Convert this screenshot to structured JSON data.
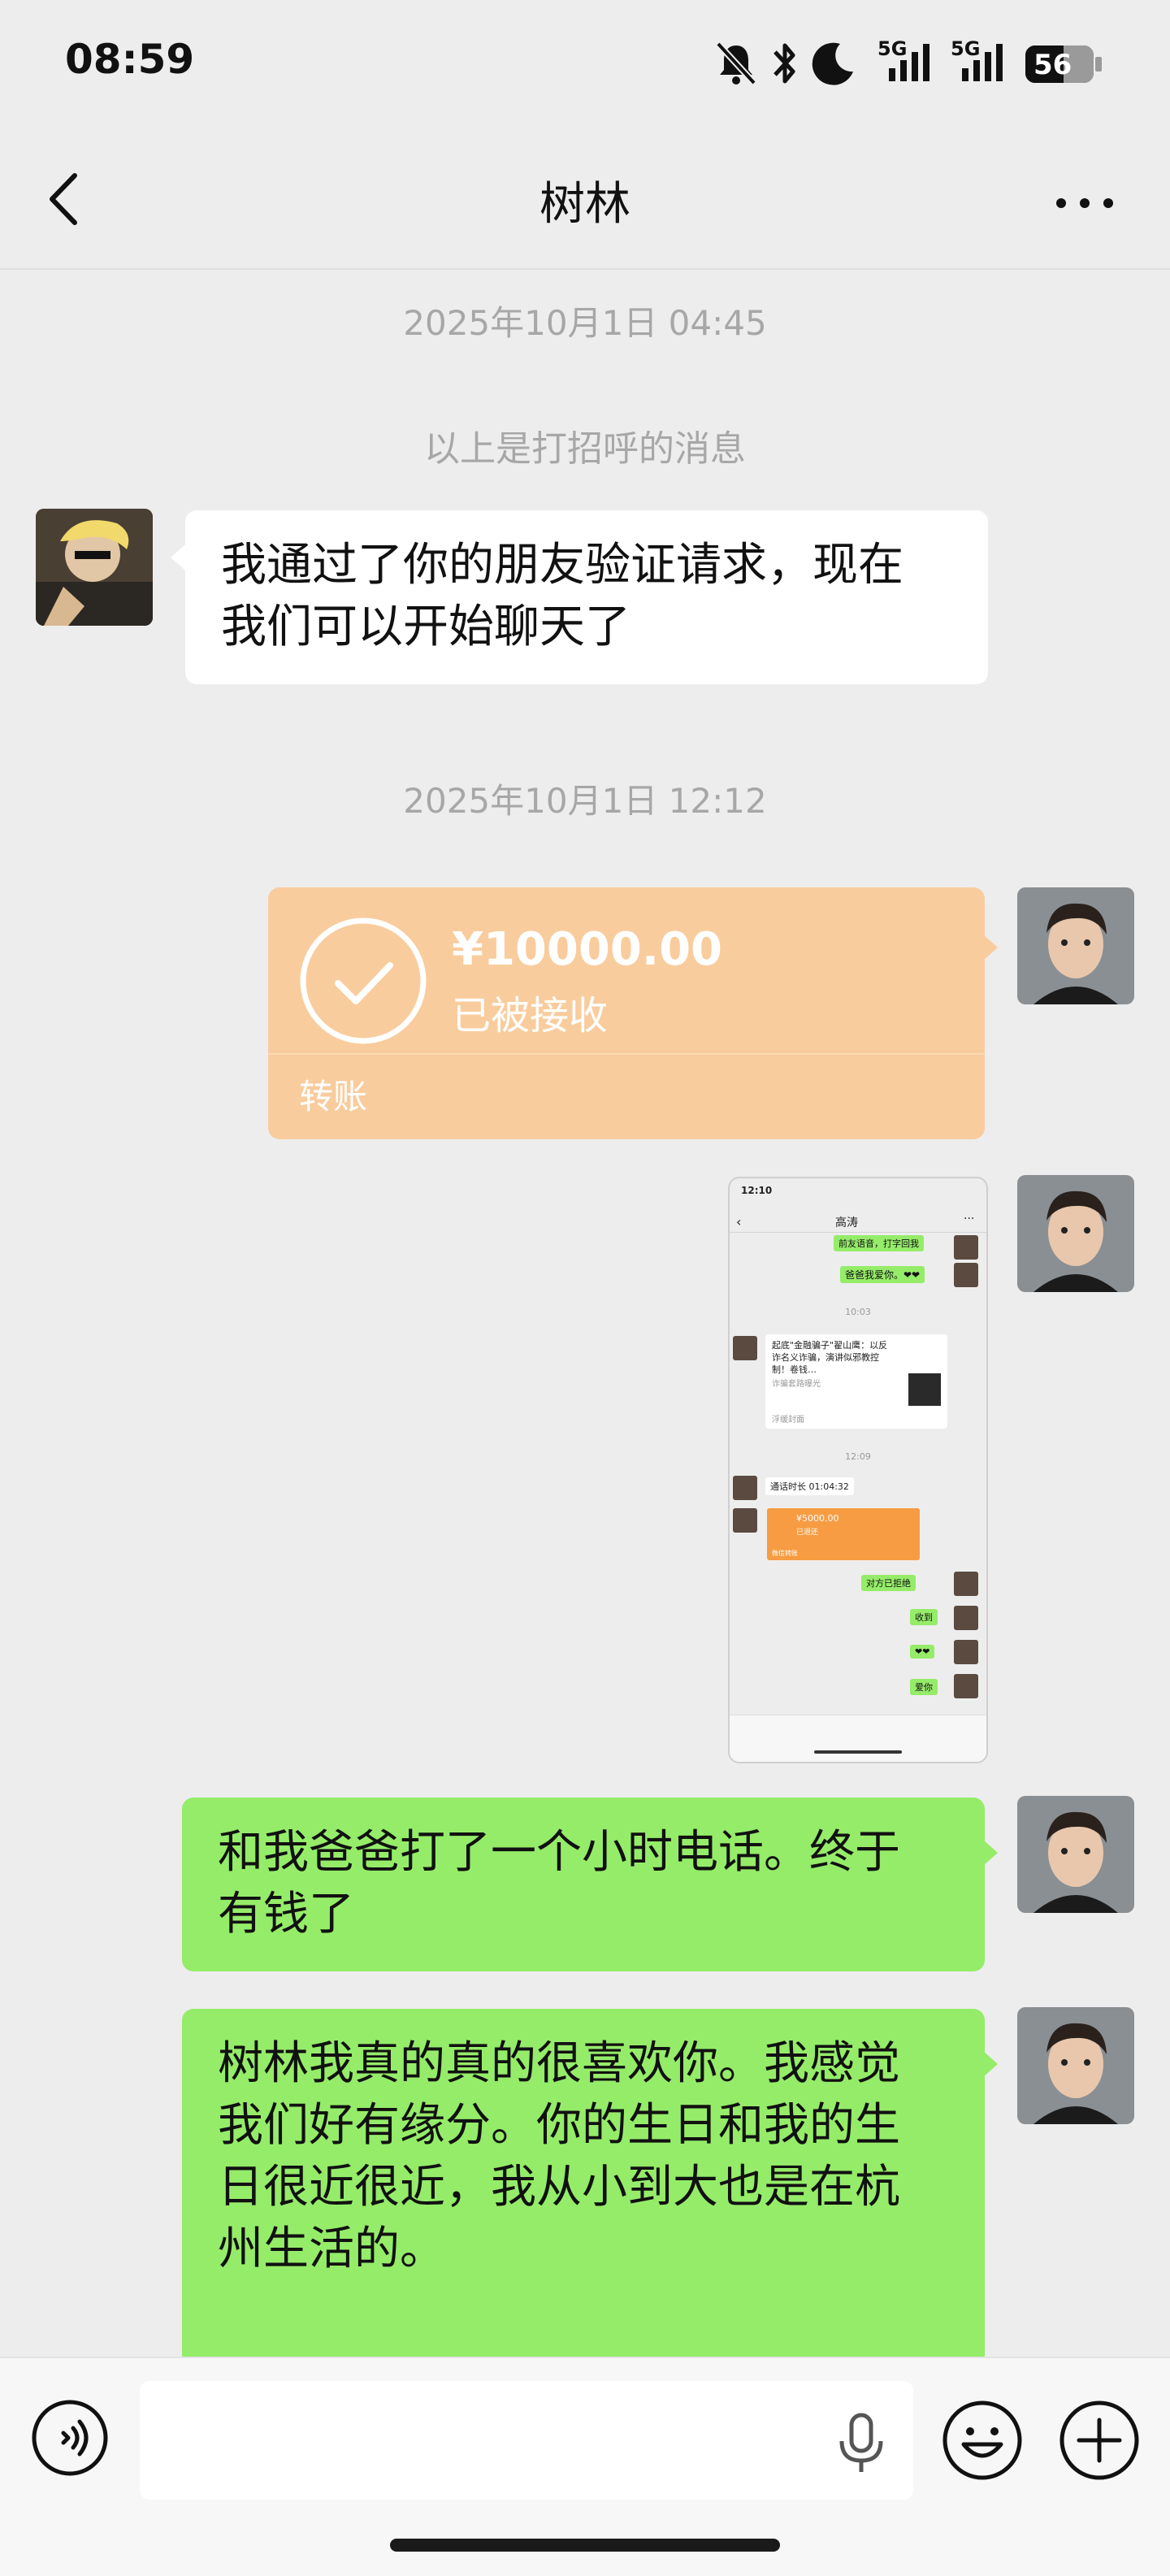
{
  "status_bar": {
    "time": "08:59",
    "icons": [
      "bell-off-icon",
      "bluetooth-icon",
      "moon-icon",
      "signal-5g-icon",
      "signal-5g-icon",
      "battery-icon"
    ],
    "signal_label_1": "5G",
    "signal_label_2": "5G",
    "battery_level": "56"
  },
  "header": {
    "title": "树林",
    "back_icon": "chevron-left-icon",
    "more_icon": "more-dots-icon"
  },
  "messages": {
    "ts1": "2025年10月1日 04:45",
    "greeting_note": "以上是打招呼的消息",
    "friend_msg_line1": "我通过了你的朋友验证请求，现在",
    "friend_msg_line2": "我们可以开始聊天了",
    "ts2": "2025年10月1日 12:12",
    "transfer": {
      "amount": "¥10000.00",
      "status": "已被接收",
      "label": "转账",
      "color": "#f9cc9d"
    },
    "msg_call_line1": "和我爸爸打了一个小时电话。终于",
    "msg_call_line2": "有钱了",
    "msg_like_line1": "树林我真的真的很喜欢你。我感觉",
    "msg_like_line2": "我们好有缘分。你的生日和我的生",
    "msg_like_line3": "日很近很近，我从小到大也是在杭",
    "msg_like_line4": "州生活的。"
  },
  "screenshot_thumb": {
    "time": "12:10",
    "title": "高涛",
    "top_cut": "前友语音，打字回我",
    "m1": "爸爸我爱你。❤❤",
    "t1": "10:03",
    "link_title": "起底\"金融骗子\"翟山鹰：以反诈名义诈骗，演讲似邪教控制！卷钱…",
    "link_src": "诈骗套路曝光",
    "link_foot": "浮缓封面",
    "t2": "12:09",
    "call": "通话时长 01:04:32",
    "mini_amount": "¥5000.00",
    "mini_status": "已退还",
    "mini_label": "微信转账",
    "m2": "对方已拒绝",
    "m3": "收到",
    "m4": "❤❤",
    "m5": "爱你"
  },
  "input_bar": {
    "voice_icon": "voice-icon",
    "mic_icon": "microphone-icon",
    "emoji_icon": "emoji-icon",
    "plus_icon": "plus-circle-icon"
  },
  "colors": {
    "background": "#ededed",
    "self_bubble": "#95ec69",
    "other_bubble": "#ffffff",
    "transfer": "#f9cc9d"
  }
}
